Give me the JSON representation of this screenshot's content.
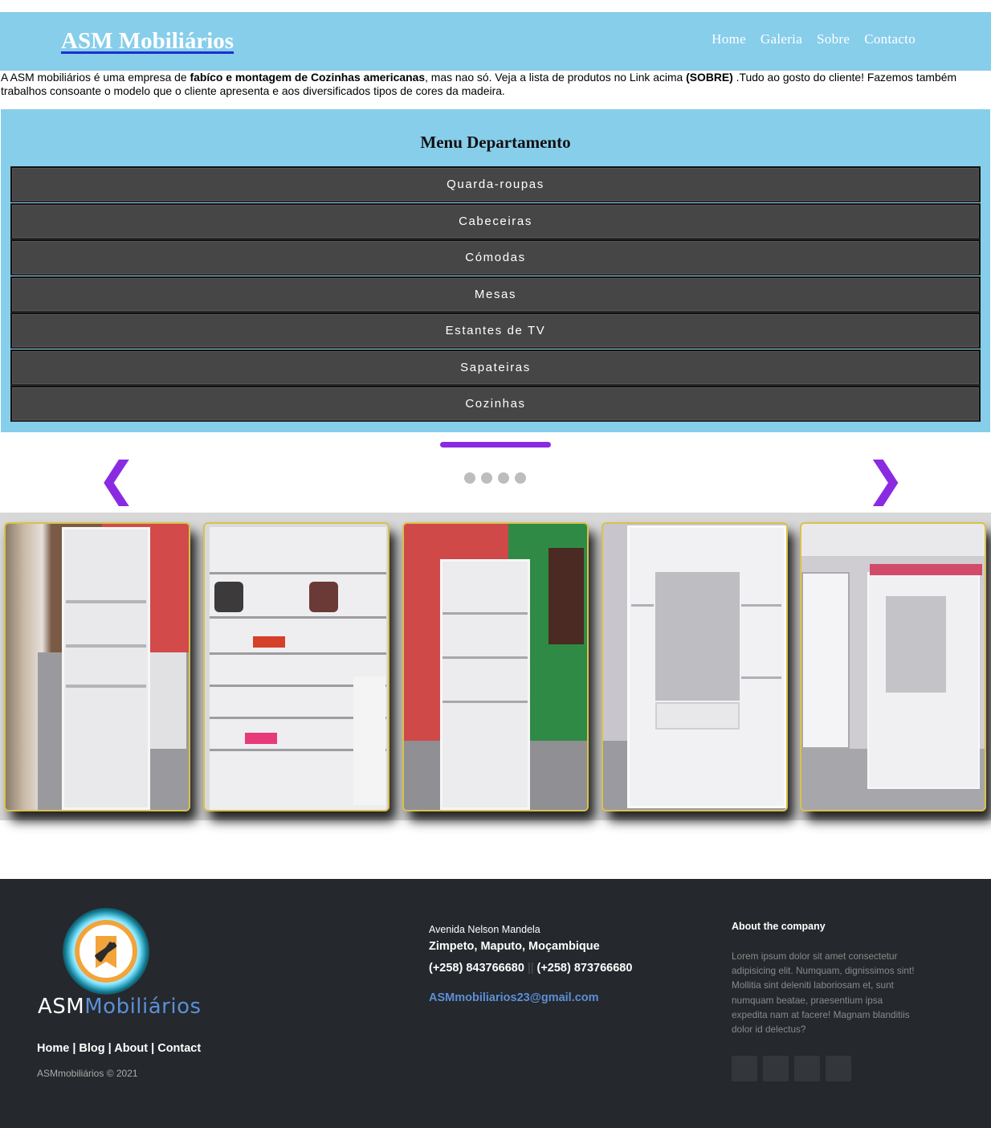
{
  "header": {
    "brand": "ASM Mobiliários",
    "nav": [
      "Home",
      "Galeria",
      "Sobre",
      "Contacto"
    ]
  },
  "intro": {
    "part1": "A ASM mobiliários é uma empresa de ",
    "bold1": "fabíco e montagem de Cozinhas americanas",
    "part2": ", mas nao só. Veja a lista de produtos no Link acima ",
    "bold2": "(SOBRE)",
    "part3": " .Tudo ao gosto do cliente! Fazemos também trabalhos consoante o modelo que o cliente apresenta e aos diversificados tipos de cores da madeira."
  },
  "department_menu": {
    "title": "Menu Departamento",
    "items": [
      "Quarda-roupas",
      "Cabeceiras",
      "Cómodas",
      "Mesas",
      "Estantes de TV",
      "Sapateiras",
      "Cozinhas"
    ]
  },
  "slider": {
    "prev_arrow": "❮",
    "next_arrow": "❯",
    "dot_count": 4,
    "accent_color": "#8a2be2"
  },
  "gallery": {
    "photo_count": 5,
    "icon": "furniture-photo"
  },
  "footer": {
    "logo_word1": "ASM",
    "logo_word2": "Mobiliários",
    "links": [
      "Home",
      "Blog",
      "About",
      "Contact"
    ],
    "copyright": "ASMmobiliários © 2021",
    "address_line1": "Avenida Nelson Mandela",
    "address_line2": "Zimpeto, Maputo, Moçambique",
    "phone1": "(+258) 843766680",
    "phone_separator": "||",
    "phone2": "(+258) 873766680",
    "email": "ASMmobiliarios23@gmail.com",
    "about_title": "About the company",
    "about_text": "Lorem ipsum dolor sit amet consectetur adipisicing elit. Numquam, dignissimos sint! Mollitia sint deleniti laboriosam et, sunt numquam beatae, praesentium ipsa expedita nam at facere! Magnam blanditiis dolor id delectus?",
    "social_count": 4
  },
  "colors": {
    "header_bg": "#87CEEB",
    "menu_item_bg": "#464646",
    "footer_bg": "#25282c",
    "email_link": "#5b8fd6",
    "photo_border": "#d8c24a"
  }
}
